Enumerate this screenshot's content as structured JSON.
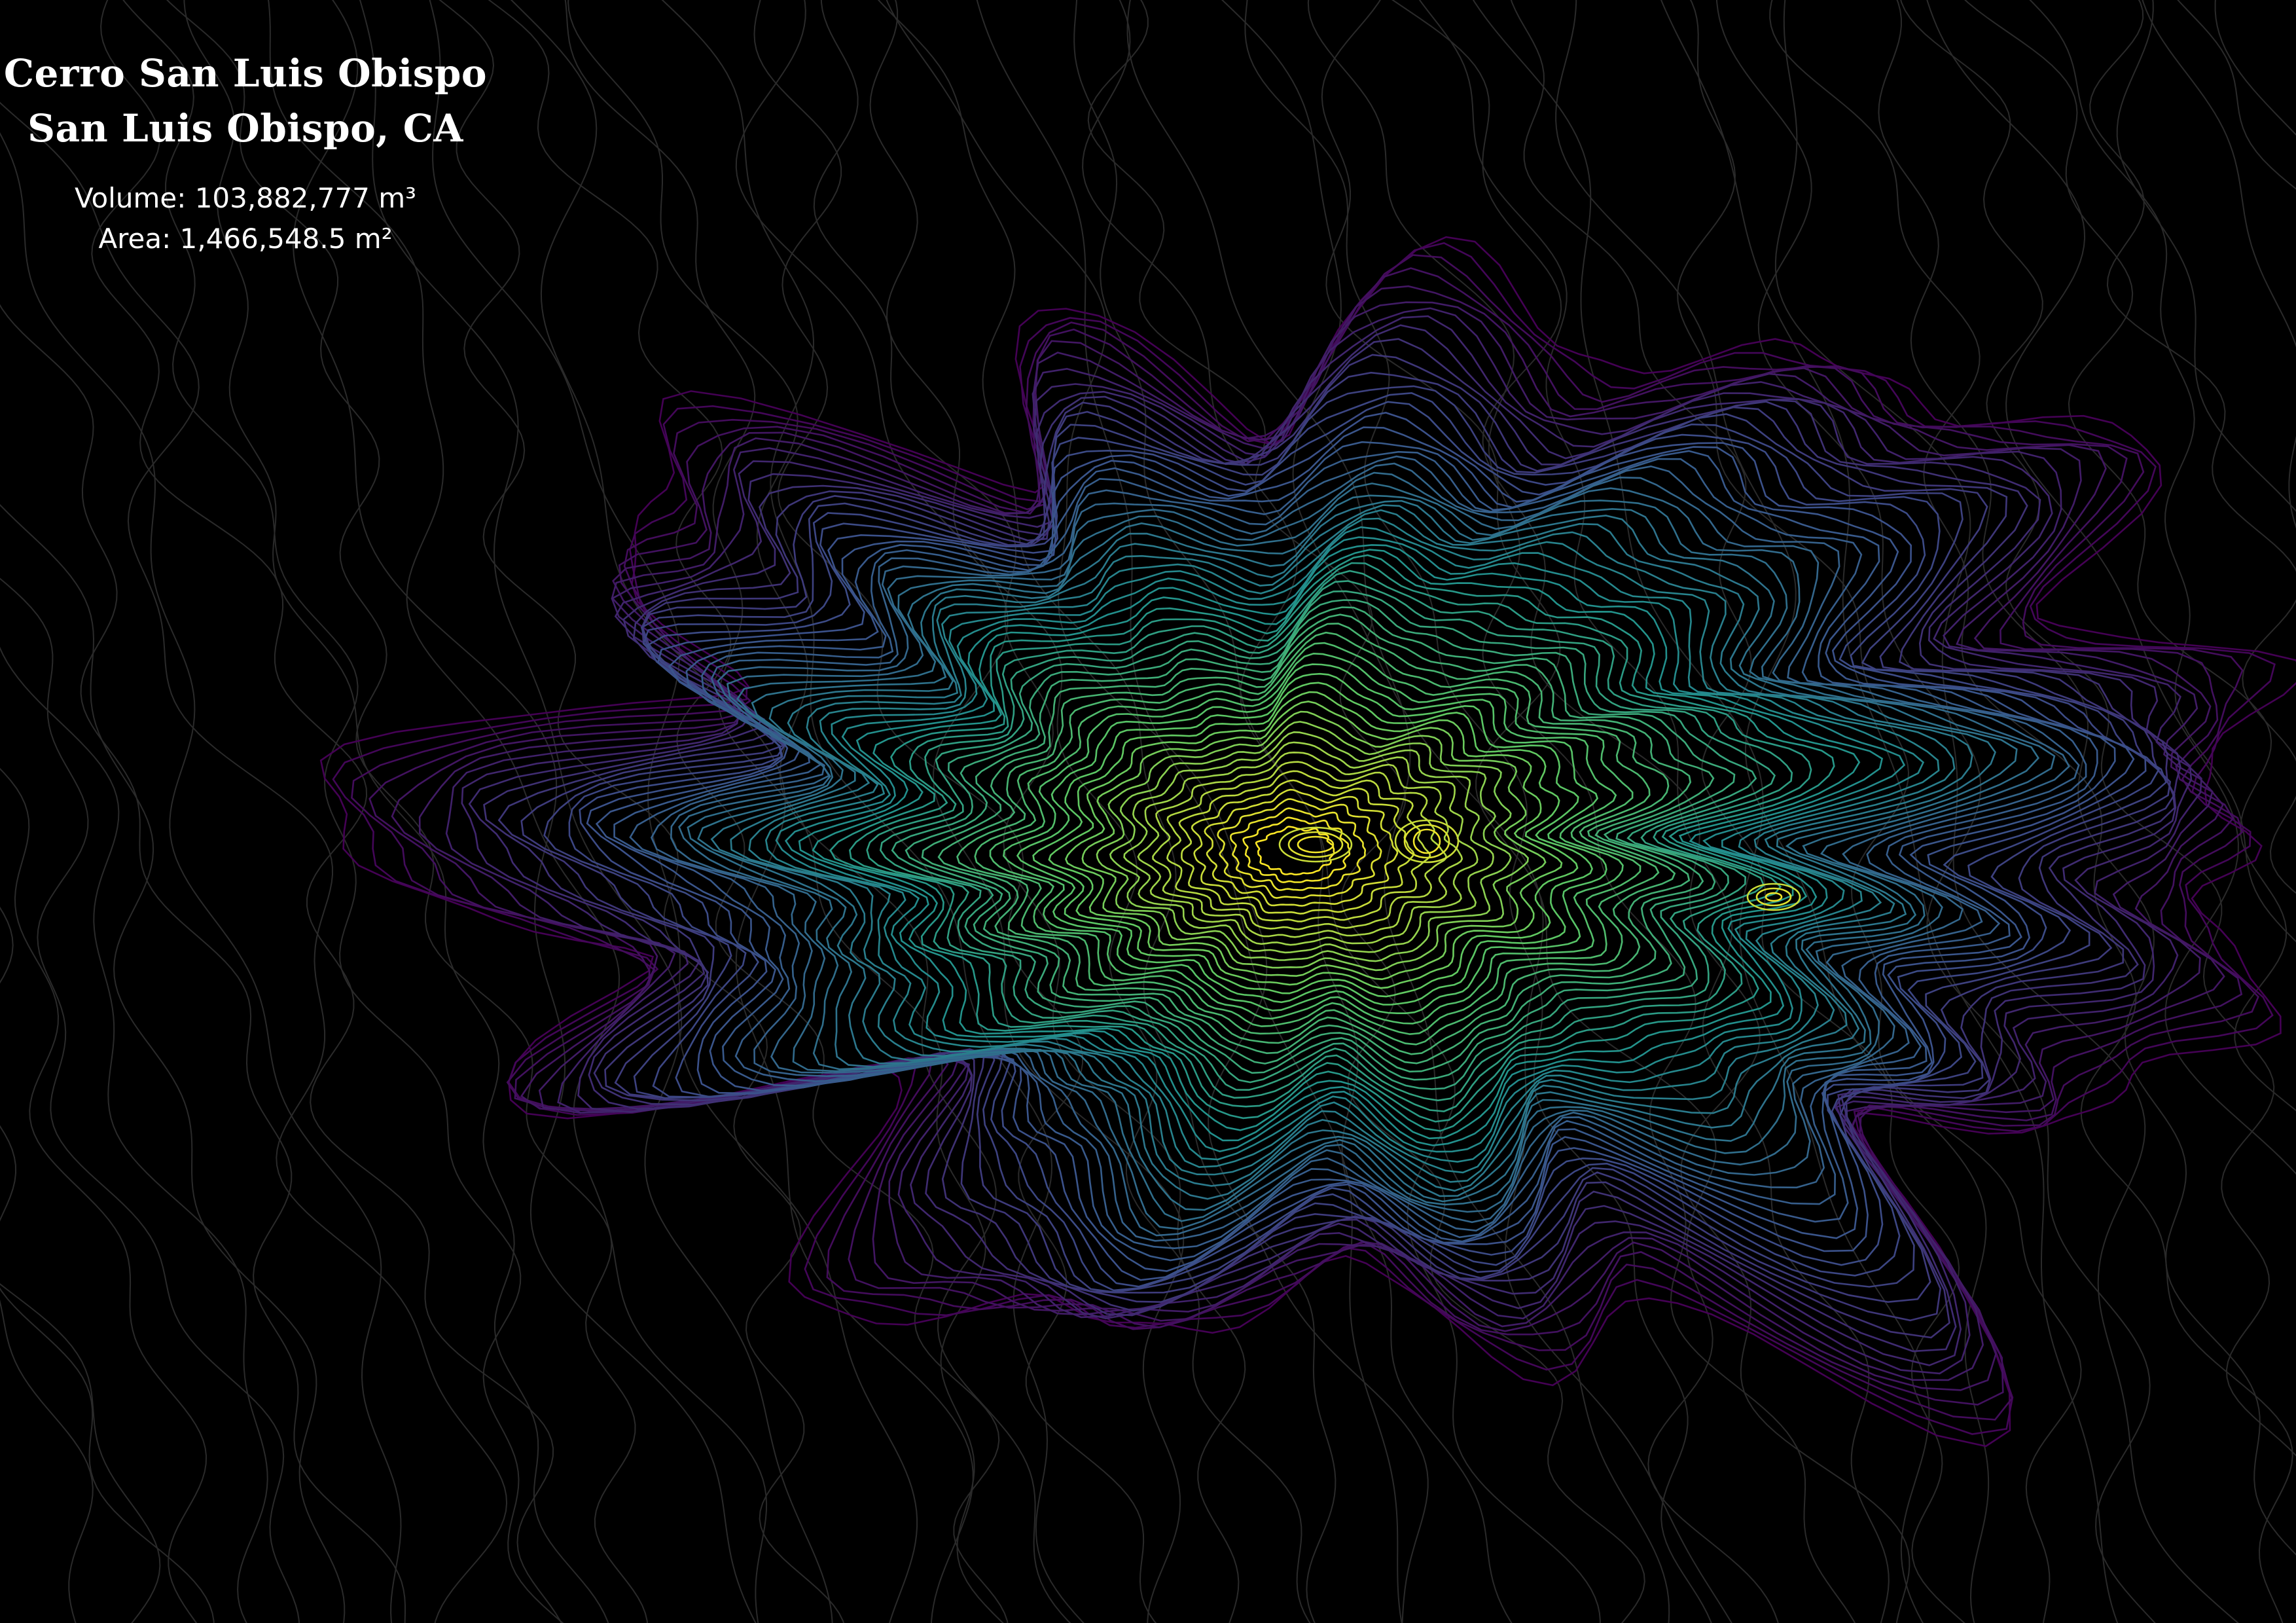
{
  "map": {
    "title_line_1": "Cerro San Luis Obispo",
    "title_line_2": "San Luis Obispo, CA",
    "volume_label": "Volume:",
    "volume_value": "103,882,777 m³",
    "area_label": "Area:",
    "area_value": "1,466,548.5 m²",
    "color_scale": [
      "#440154",
      "#3b528b",
      "#21918c",
      "#5ec962",
      "#fde725"
    ],
    "background_contour_color": "#2a2a2a",
    "background_color": "#000000"
  }
}
